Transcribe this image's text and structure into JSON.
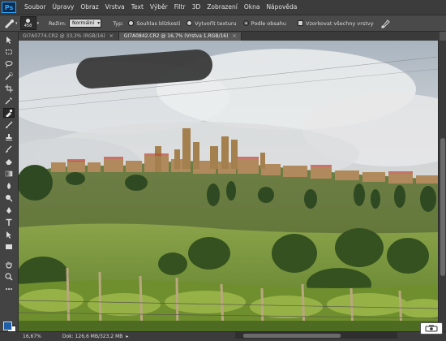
{
  "app": {
    "logo_text": "Ps"
  },
  "menu": [
    "Soubor",
    "Úpravy",
    "Obraz",
    "Vrstva",
    "Text",
    "Výběr",
    "Filtr",
    "3D",
    "Zobrazení",
    "Okna",
    "Nápověda"
  ],
  "options": {
    "brush_size": "458",
    "mode_label": "Režim:",
    "mode_value": "Normální",
    "type_label": "Typ:",
    "type_options": [
      "Souhlas blízkosti",
      "Vytvořit texturu",
      "Podle obsahu"
    ],
    "type_selected_index": 2,
    "sample_all_layers": "Vzorkovat všechny vrstvy"
  },
  "tabs": [
    {
      "label": "GI7A0774.CR2 @ 33,3% (RGB/16)",
      "close": "×"
    },
    {
      "label": "GI7A0842.CR2 @ 16,7% (Vrstva 1,RGB/16)",
      "close": "×"
    }
  ],
  "active_tab_index": 1,
  "tools": [
    "move-tool",
    "marquee-tool",
    "lasso-tool",
    "quick-selection-tool",
    "crop-tool",
    "eyedropper-tool",
    "spot-healing-brush-tool",
    "brush-tool",
    "clone-stamp-tool",
    "history-brush-tool",
    "eraser-tool",
    "gradient-tool",
    "blur-tool",
    "dodge-tool",
    "pen-tool",
    "type-tool",
    "path-selection-tool",
    "rectangle-tool",
    "hand-tool",
    "zoom-tool"
  ],
  "selected_tool_index": 6,
  "colors": {
    "foreground": "#1f5fa8",
    "background": "#ffffff",
    "accent": "#31a8ff"
  },
  "status": {
    "zoom": "16,67%",
    "doc_info": "Dok: 126,6 MB/323,2 MB"
  }
}
